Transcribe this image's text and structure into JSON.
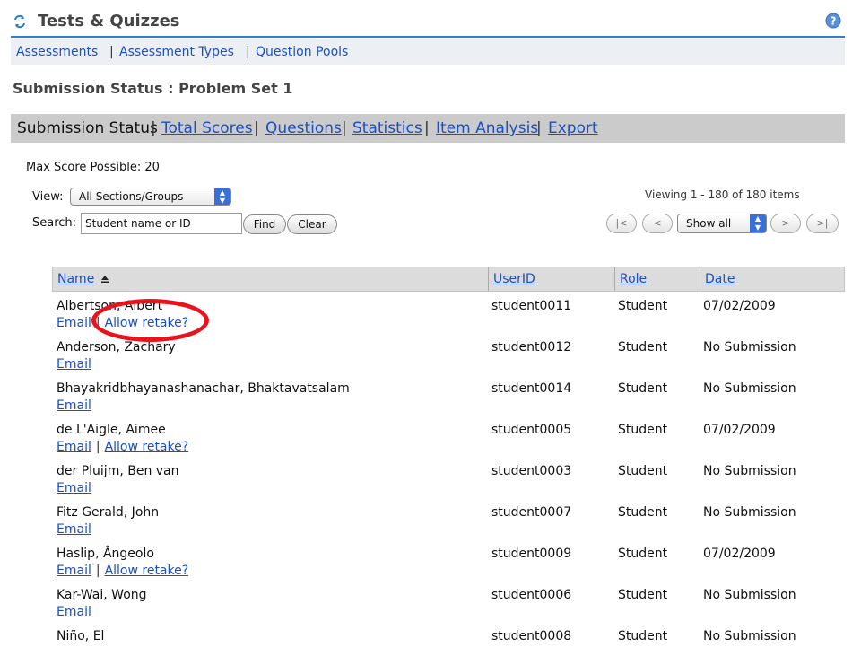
{
  "tool": {
    "title": "Tests & Quizzes",
    "icons": {
      "reload": "reload-icon",
      "help": "help-icon"
    }
  },
  "topnav": {
    "items": [
      "Assessments",
      "Assessment Types",
      "Question Pools"
    ],
    "separator": "|"
  },
  "page_title": "Submission Status : Problem Set 1",
  "subnav": {
    "current": "Submission Status",
    "links": [
      "Total Scores",
      "Questions",
      "Statistics",
      "Item Analysis",
      "Export"
    ],
    "separator": "|"
  },
  "max_score": "Max Score Possible: 20",
  "view": {
    "label": "View:",
    "selected": "All Sections/Groups"
  },
  "search": {
    "label": "Search:",
    "value": "Student name or ID",
    "find": "Find",
    "clear": "Clear"
  },
  "paging": {
    "viewing": "Viewing 1 - 180 of 180 items",
    "first": "|<",
    "prev": "<",
    "show": "Show all",
    "next": ">",
    "last": ">|"
  },
  "table": {
    "headers": {
      "name": "Name",
      "userid": "UserID",
      "role": "Role",
      "date": "Date"
    },
    "email_label": "Email",
    "retake_label": "Allow retake?",
    "rows": [
      {
        "name": "Albertson, Albert",
        "userid": "student0011",
        "role": "Student",
        "date": "07/02/2009"
      },
      {
        "name": "Anderson, Zachary",
        "userid": "student0012",
        "role": "Student",
        "date": "No Submission"
      },
      {
        "name": "Bhayakridbhayanashanachar, Bhaktavatsalam",
        "userid": "student0014",
        "role": "Student",
        "date": "No Submission"
      },
      {
        "name": "de L'Aigle, Aimee",
        "userid": "student0005",
        "role": "Student",
        "date": "07/02/2009"
      },
      {
        "name": "der Pluijm, Ben van",
        "userid": "student0003",
        "role": "Student",
        "date": "No Submission"
      },
      {
        "name": "Fitz Gerald, John",
        "userid": "student0007",
        "role": "Student",
        "date": "No Submission"
      },
      {
        "name": "Haslip, Ângeolo",
        "userid": "student0009",
        "role": "Student",
        "date": "07/02/2009"
      },
      {
        "name": "Kar-Wai, Wong",
        "userid": "student0006",
        "role": "Student",
        "date": "No Submission"
      },
      {
        "name": "Niño, El",
        "userid": "student0008",
        "role": "Student",
        "date": "No Submission"
      }
    ]
  },
  "annotation": {
    "color": "#e8131b"
  }
}
